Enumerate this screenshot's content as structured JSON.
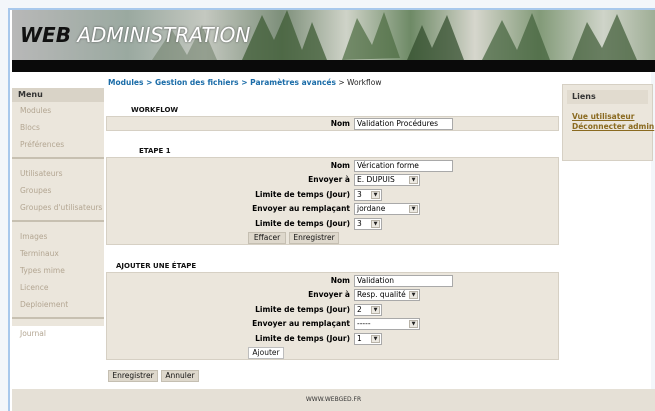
{
  "header": {
    "logo_web": "WEB",
    "logo_admin": " ADMINISTRATION"
  },
  "breadcrumb": {
    "modules": "Modules",
    "gestion": "Gestion des fichiers",
    "params": "Paramètres avancés",
    "sep": " > ",
    "current": "Workflow"
  },
  "sidebar": {
    "title": "Menu",
    "group1": [
      "Modules",
      "Blocs",
      "Préférences"
    ],
    "group2": [
      "Utilisateurs",
      "Groupes",
      "Groupes d'utilisateurs"
    ],
    "group3": [
      "Images",
      "Terminaux",
      "Types mime",
      "Licence",
      "Deploiement"
    ],
    "group4": [
      "Journal"
    ]
  },
  "liens": {
    "title": "Liens",
    "links": [
      "Vue utilisateur",
      "Déconnecter admin"
    ]
  },
  "workflow": {
    "title": "WORKFLOW",
    "nom_label": "Nom",
    "nom_value": "Validation Procédures"
  },
  "etape1": {
    "title": "ETAPE 1",
    "nom_label": "Nom",
    "nom_value": "Vérication forme",
    "envoyer_label": "Envoyer à",
    "envoyer_value": "E. DUPUIS",
    "limite_label": "Limite de temps (Jour)",
    "limite_value": "3",
    "remplacant_label": "Envoyer au remplaçant",
    "remplacant_value": "jordane",
    "limite2_label": "Limite de temps (Jour)",
    "limite2_value": "3",
    "effacer_label": "Effacer",
    "enregistrer_label": "Enregistrer"
  },
  "ajouter": {
    "title": "AJOUTER UNE ÉTAPE",
    "nom_label": "Nom",
    "nom_value": "Validation",
    "envoyer_label": "Envoyer à",
    "envoyer_value": "Resp. qualité",
    "limite_label": "Limite de temps (Jour)",
    "limite_value": "2",
    "remplacant_label": "Envoyer au remplaçant",
    "remplacant_value": "-----",
    "limite2_label": "Limite de temps (Jour)",
    "limite2_value": "1",
    "ajouter_label": "Ajouter"
  },
  "bottom": {
    "enregistrer_label": "Enregistrer",
    "annuler_label": "Annuler"
  },
  "footer": {
    "text": "WWW.WEBGED.FR"
  },
  "icons": {
    "dropdown": "chevron-down-icon"
  }
}
